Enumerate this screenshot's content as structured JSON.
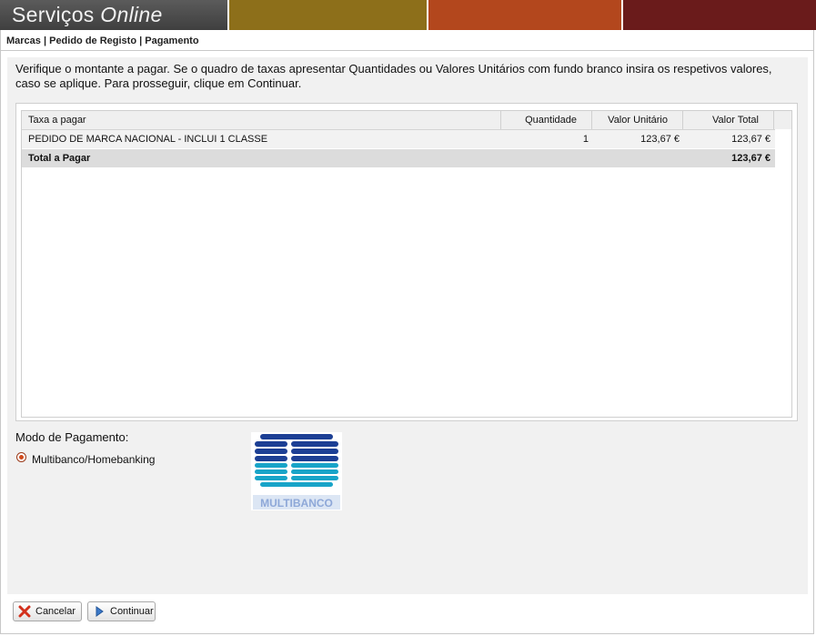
{
  "header": {
    "title_bold": "Serviços",
    "title_light": "Online"
  },
  "breadcrumb": "Marcas | Pedido de Registo | Pagamento",
  "instructions": "Verifique o montante a pagar. Se o quadro de taxas apresentar Quantidades ou Valores Unitários com fundo branco insira os respetivos valores, caso se aplique. Para prosseguir, clique em Continuar.",
  "table": {
    "columns": [
      "Taxa a pagar",
      "Quantidade",
      "Valor Unitário",
      "Valor Total"
    ],
    "rows": [
      {
        "taxa": "PEDIDO DE MARCA NACIONAL - INCLUI 1 CLASSE",
        "quantidade": "1",
        "valor_unitario": "123,67 €",
        "valor_total": "123,67 €"
      }
    ],
    "total": {
      "label": "Total a Pagar",
      "value": "123,67 €"
    }
  },
  "payment": {
    "label": "Modo de Pagamento:",
    "option": "Multibanco/Homebanking",
    "logo_text": "MULTIBANCO"
  },
  "buttons": {
    "cancel": "Cancelar",
    "continue": "Continuar"
  },
  "colors": {
    "header_olive": "#8d6f1a",
    "header_orange": "#b3471d",
    "header_maroon": "#6a1b1b",
    "multibanco_blue": "#1c3f94",
    "multibanco_cyan": "#18a4c8"
  }
}
